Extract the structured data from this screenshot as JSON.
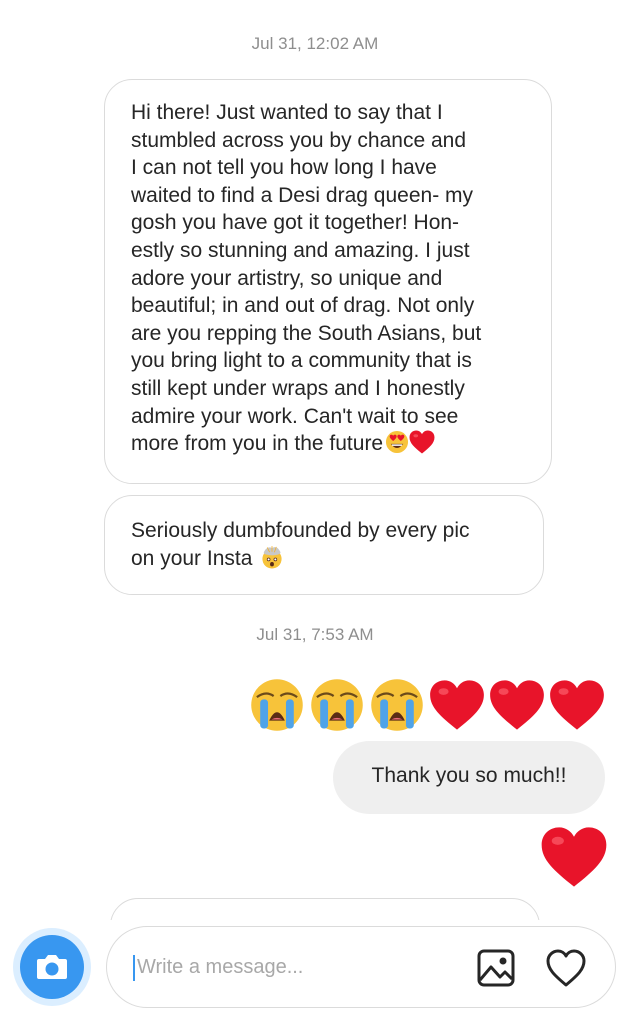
{
  "thread": {
    "timestamps": [
      "Jul 31, 12:02 AM",
      "Jul 31, 7:53 AM"
    ],
    "incoming": [
      {
        "lines": [
          "Hi there! Just wanted to say that I",
          "stumbled across you by chance and",
          "I can not tell you how long I have",
          "waited to find a Desi drag queen- my",
          "gosh you have got it together! Hon-",
          "estly so stunning and amazing. I just",
          "adore your artistry, so unique and",
          "beautiful; in and out of drag. Not only",
          "are you repping the South Asians, but",
          "you bring light to a community that is",
          "still kept under wraps and I honestly",
          "admire your work. Can't wait to see",
          "more from you in the future"
        ],
        "emojis": [
          "heart-eyes-emoji",
          "red-heart-emoji"
        ]
      },
      {
        "lines": [
          "Seriously dumbfounded by every pic",
          "on your Insta"
        ],
        "emojis": [
          "exploding-head-emoji"
        ]
      }
    ],
    "outgoing_emojis": [
      "loudly-crying-emoji",
      "loudly-crying-emoji",
      "loudly-crying-emoji",
      "red-heart-emoji",
      "red-heart-emoji",
      "red-heart-emoji"
    ],
    "outgoing_text": "Thank you so much!!",
    "outgoing_reaction": "red-heart-emoji"
  },
  "composer": {
    "placeholder": "Write a message...",
    "camera_icon": "camera-icon",
    "gallery_icon": "image-gallery-icon",
    "like_icon": "heart-outline-icon"
  },
  "colors": {
    "accent": "#3897f0",
    "heart": "#e8142a",
    "outgoing_bubble": "#efefef",
    "border": "#dbdbdb",
    "timestamp": "#8e8e8e"
  }
}
